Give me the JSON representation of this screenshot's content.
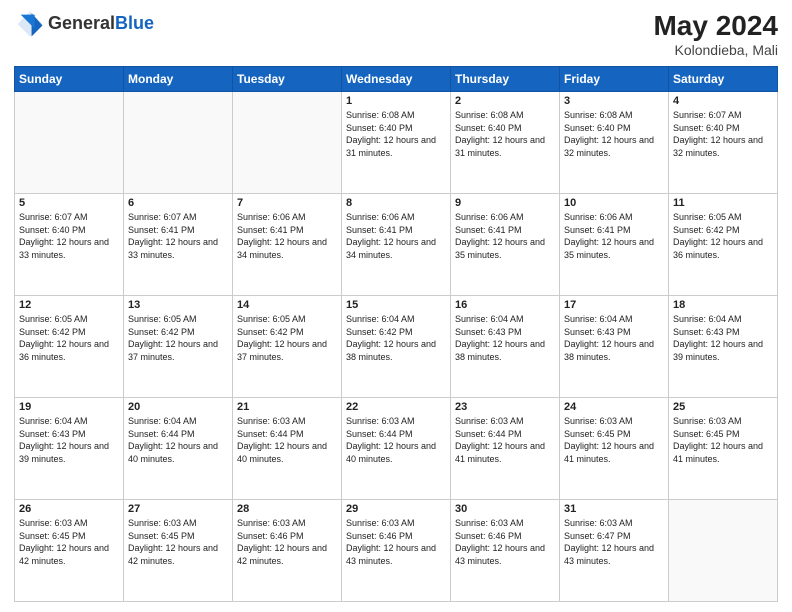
{
  "header": {
    "logo": {
      "line1": "General",
      "line2": "Blue"
    },
    "title": "May 2024",
    "location": "Kolondieba, Mali"
  },
  "weekdays": [
    "Sunday",
    "Monday",
    "Tuesday",
    "Wednesday",
    "Thursday",
    "Friday",
    "Saturday"
  ],
  "weeks": [
    [
      {
        "day": "",
        "empty": true
      },
      {
        "day": "",
        "empty": true
      },
      {
        "day": "",
        "empty": true
      },
      {
        "day": "1",
        "sunrise": "6:08 AM",
        "sunset": "6:40 PM",
        "daylight": "12 hours and 31 minutes."
      },
      {
        "day": "2",
        "sunrise": "6:08 AM",
        "sunset": "6:40 PM",
        "daylight": "12 hours and 31 minutes."
      },
      {
        "day": "3",
        "sunrise": "6:08 AM",
        "sunset": "6:40 PM",
        "daylight": "12 hours and 32 minutes."
      },
      {
        "day": "4",
        "sunrise": "6:07 AM",
        "sunset": "6:40 PM",
        "daylight": "12 hours and 32 minutes."
      }
    ],
    [
      {
        "day": "5",
        "sunrise": "6:07 AM",
        "sunset": "6:40 PM",
        "daylight": "12 hours and 33 minutes."
      },
      {
        "day": "6",
        "sunrise": "6:07 AM",
        "sunset": "6:41 PM",
        "daylight": "12 hours and 33 minutes."
      },
      {
        "day": "7",
        "sunrise": "6:06 AM",
        "sunset": "6:41 PM",
        "daylight": "12 hours and 34 minutes."
      },
      {
        "day": "8",
        "sunrise": "6:06 AM",
        "sunset": "6:41 PM",
        "daylight": "12 hours and 34 minutes."
      },
      {
        "day": "9",
        "sunrise": "6:06 AM",
        "sunset": "6:41 PM",
        "daylight": "12 hours and 35 minutes."
      },
      {
        "day": "10",
        "sunrise": "6:06 AM",
        "sunset": "6:41 PM",
        "daylight": "12 hours and 35 minutes."
      },
      {
        "day": "11",
        "sunrise": "6:05 AM",
        "sunset": "6:42 PM",
        "daylight": "12 hours and 36 minutes."
      }
    ],
    [
      {
        "day": "12",
        "sunrise": "6:05 AM",
        "sunset": "6:42 PM",
        "daylight": "12 hours and 36 minutes."
      },
      {
        "day": "13",
        "sunrise": "6:05 AM",
        "sunset": "6:42 PM",
        "daylight": "12 hours and 37 minutes."
      },
      {
        "day": "14",
        "sunrise": "6:05 AM",
        "sunset": "6:42 PM",
        "daylight": "12 hours and 37 minutes."
      },
      {
        "day": "15",
        "sunrise": "6:04 AM",
        "sunset": "6:42 PM",
        "daylight": "12 hours and 38 minutes."
      },
      {
        "day": "16",
        "sunrise": "6:04 AM",
        "sunset": "6:43 PM",
        "daylight": "12 hours and 38 minutes."
      },
      {
        "day": "17",
        "sunrise": "6:04 AM",
        "sunset": "6:43 PM",
        "daylight": "12 hours and 38 minutes."
      },
      {
        "day": "18",
        "sunrise": "6:04 AM",
        "sunset": "6:43 PM",
        "daylight": "12 hours and 39 minutes."
      }
    ],
    [
      {
        "day": "19",
        "sunrise": "6:04 AM",
        "sunset": "6:43 PM",
        "daylight": "12 hours and 39 minutes."
      },
      {
        "day": "20",
        "sunrise": "6:04 AM",
        "sunset": "6:44 PM",
        "daylight": "12 hours and 40 minutes."
      },
      {
        "day": "21",
        "sunrise": "6:03 AM",
        "sunset": "6:44 PM",
        "daylight": "12 hours and 40 minutes."
      },
      {
        "day": "22",
        "sunrise": "6:03 AM",
        "sunset": "6:44 PM",
        "daylight": "12 hours and 40 minutes."
      },
      {
        "day": "23",
        "sunrise": "6:03 AM",
        "sunset": "6:44 PM",
        "daylight": "12 hours and 41 minutes."
      },
      {
        "day": "24",
        "sunrise": "6:03 AM",
        "sunset": "6:45 PM",
        "daylight": "12 hours and 41 minutes."
      },
      {
        "day": "25",
        "sunrise": "6:03 AM",
        "sunset": "6:45 PM",
        "daylight": "12 hours and 41 minutes."
      }
    ],
    [
      {
        "day": "26",
        "sunrise": "6:03 AM",
        "sunset": "6:45 PM",
        "daylight": "12 hours and 42 minutes."
      },
      {
        "day": "27",
        "sunrise": "6:03 AM",
        "sunset": "6:45 PM",
        "daylight": "12 hours and 42 minutes."
      },
      {
        "day": "28",
        "sunrise": "6:03 AM",
        "sunset": "6:46 PM",
        "daylight": "12 hours and 42 minutes."
      },
      {
        "day": "29",
        "sunrise": "6:03 AM",
        "sunset": "6:46 PM",
        "daylight": "12 hours and 43 minutes."
      },
      {
        "day": "30",
        "sunrise": "6:03 AM",
        "sunset": "6:46 PM",
        "daylight": "12 hours and 43 minutes."
      },
      {
        "day": "31",
        "sunrise": "6:03 AM",
        "sunset": "6:47 PM",
        "daylight": "12 hours and 43 minutes."
      },
      {
        "day": "",
        "empty": true
      }
    ]
  ],
  "labels": {
    "sunrise_prefix": "Sunrise: ",
    "sunset_prefix": "Sunset: ",
    "daylight_prefix": "Daylight: "
  }
}
